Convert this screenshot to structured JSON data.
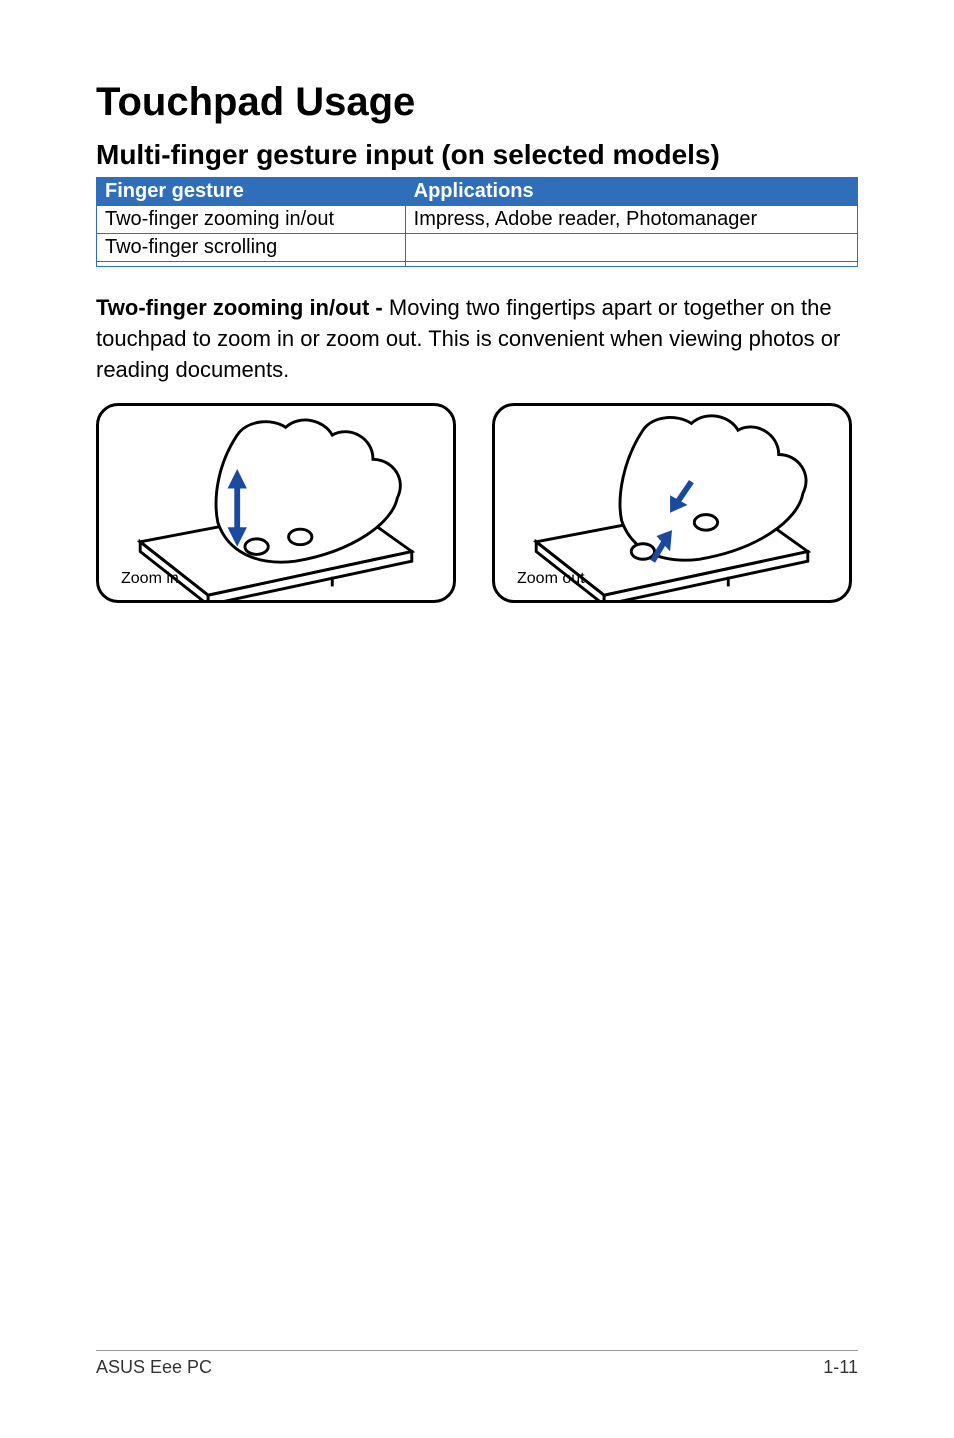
{
  "title": "Touchpad Usage",
  "subtitle": "Multi-finger gesture input (on selected models)",
  "table": {
    "headers": [
      "Finger gesture",
      "Applications"
    ],
    "rows": [
      [
        "Two-finger zooming in/out",
        "Impress, Adobe reader, Photomanager"
      ],
      [
        "Two-finger scrolling",
        ""
      ],
      [
        "",
        ""
      ]
    ]
  },
  "paragraph": {
    "lead": "Two-finger zooming in/out - ",
    "body": "Moving two fingertips apart or together on the touchpad to zoom in or zoom out. This is convenient when viewing photos or reading documents."
  },
  "illustrations": {
    "zoom_in_caption": "Zoom in",
    "zoom_out_caption": "Zoom out"
  },
  "footer": {
    "left": "ASUS Eee PC",
    "right": "1-11"
  }
}
